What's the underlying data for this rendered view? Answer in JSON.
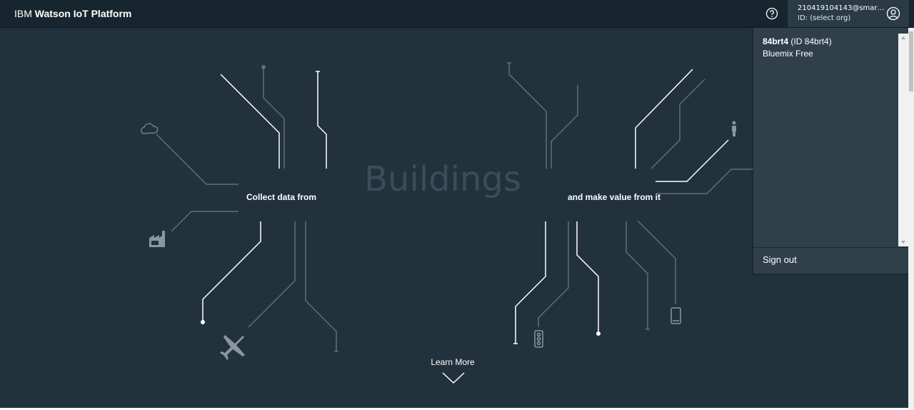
{
  "header": {
    "brand_prefix": "IBM",
    "brand_name": "Watson IoT Platform",
    "help_icon": "help-circle-icon",
    "account_email": "210419104143@smartin...",
    "account_id": "ID: (select org)",
    "avatar_icon": "user-avatar-icon"
  },
  "hero": {
    "rotating_word": "Buildings",
    "left_caption": "Collect data from",
    "right_caption": "and make value from it",
    "learn_more": "Learn More",
    "icons": [
      "cloud-icon",
      "factory-icon",
      "airplane-icon",
      "traffic-light-icon",
      "person-icon",
      "mobile-phone-icon"
    ]
  },
  "account_menu": {
    "org_name": "84brt4",
    "org_id": "(ID 84brt4)",
    "org_plan": "Bluemix Free",
    "sign_out": "Sign out"
  },
  "colors": {
    "background": "#22323c",
    "header": "#17262e",
    "menu": "#2f404b",
    "circuit_line": "#5f6f78",
    "circuit_highlight": "#ffffff"
  }
}
